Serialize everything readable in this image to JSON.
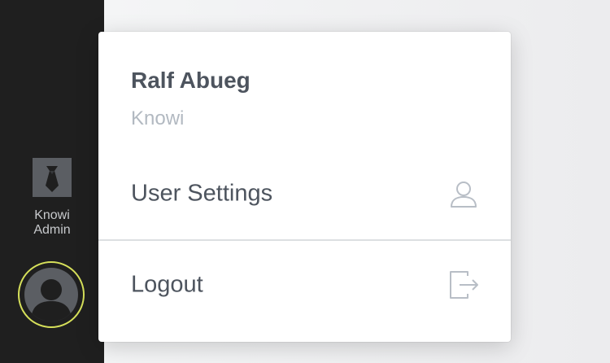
{
  "sidebar": {
    "admin_label": "Knowi Admin",
    "admin_icon": "tie-icon",
    "avatar_icon": "user-avatar-icon",
    "avatar_ring_color": "#d6e05a"
  },
  "menu": {
    "user_name": "Ralf Abueg",
    "organization": "Knowi",
    "items": [
      {
        "label": "User Settings",
        "icon": "user-outline-icon"
      },
      {
        "label": "Logout",
        "icon": "logout-icon"
      }
    ]
  }
}
